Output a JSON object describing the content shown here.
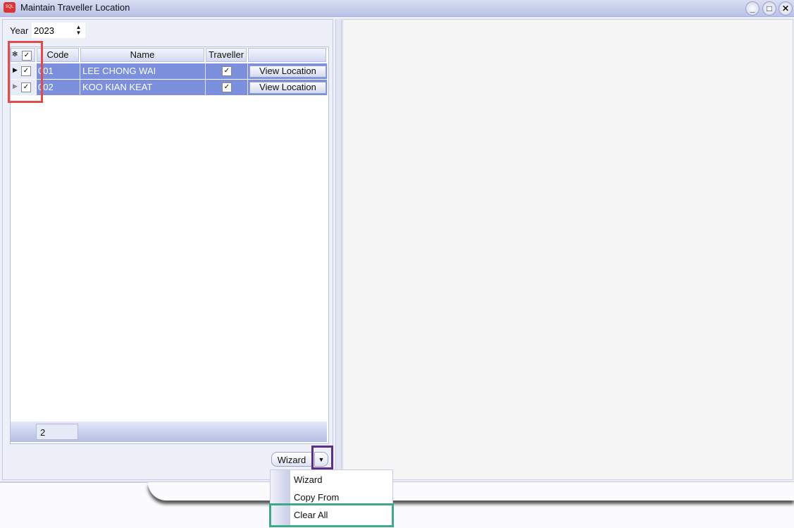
{
  "window": {
    "title": "Maintain Traveller Location",
    "minimize": "_",
    "maximize": "□",
    "close": "✕"
  },
  "year": {
    "label": "Year",
    "value": "2023"
  },
  "grid": {
    "columns": [
      "Code",
      "Name",
      "Traveller",
      ""
    ],
    "rows": [
      {
        "code": "001",
        "name": "LEE CHONG WAI",
        "selected": true,
        "traveller": true,
        "button": "View Location"
      },
      {
        "code": "002",
        "name": "KOO KIAN KEAT",
        "selected": true,
        "traveller": true,
        "button": "View Location"
      }
    ],
    "footer_count": "2"
  },
  "wizard": {
    "label": "Wizard",
    "menu": [
      "Wizard",
      "Copy From",
      "Clear All"
    ]
  },
  "highlights": {
    "red": "#e04b4b",
    "purple": "#5b2d8e",
    "green": "#3fa888"
  }
}
